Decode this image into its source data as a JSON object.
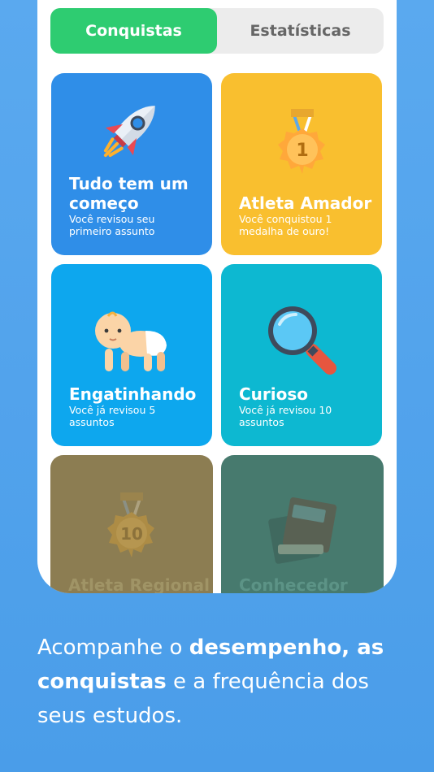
{
  "tabs": {
    "achievements": "Conquistas",
    "statistics": "Estatísticas"
  },
  "cards": [
    {
      "title": "Tudo tem um começo",
      "desc": "Você revisou seu primeiro assunto",
      "icon": "rocket-icon"
    },
    {
      "title": "Atleta Amador",
      "desc": "Você conquistou 1 medalha de ouro!",
      "icon": "medal-1-icon",
      "medal_number": "1"
    },
    {
      "title": "Engatinhando",
      "desc": "Você já revisou 5 assuntos",
      "icon": "baby-icon"
    },
    {
      "title": "Curioso",
      "desc": "Você já revisou 10 assuntos",
      "icon": "magnifier-icon"
    },
    {
      "title": "Atleta Regional",
      "icon": "medal-10-icon",
      "medal_number": "10"
    },
    {
      "title": "Conhecedor",
      "icon": "books-icon"
    }
  ],
  "caption": {
    "p1": "Acompanhe o ",
    "b1": "desempenho, as conquistas",
    "p2": " e a frequência dos seus estudos."
  },
  "colors": {
    "background": "#4a9de9",
    "active_tab": "#2ecc71",
    "card1": "#2f8ee8",
    "card2": "#f9bf2f",
    "card3": "#0da7ee",
    "card4": "#0db8d1",
    "card5": "#8c7d52",
    "card6": "#477a6e"
  }
}
